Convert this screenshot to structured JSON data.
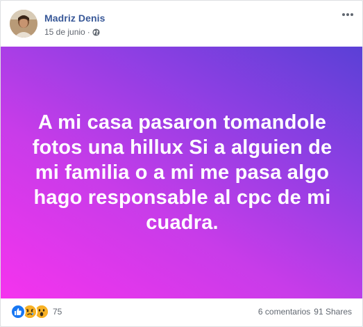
{
  "post": {
    "author": "Madriz Denis",
    "date": "15 de junio",
    "separator": "·",
    "privacy_icon": "globe-icon",
    "more_icon": "more-options-icon",
    "text": "A mi casa pasaron tomandole fotos una hillux Si a alguien de mi familia o a mi me pasa algo hago responsable al cpc de mi cuadra.",
    "background_colors": [
      "#f533ee",
      "#c83ce9",
      "#8d3fe3",
      "#5a40d6"
    ]
  },
  "footer": {
    "reactions": [
      "like-icon",
      "sad-icon",
      "wow-icon"
    ],
    "reaction_count": "75",
    "comments": "6 comentarios",
    "shares": "91 Shares"
  }
}
